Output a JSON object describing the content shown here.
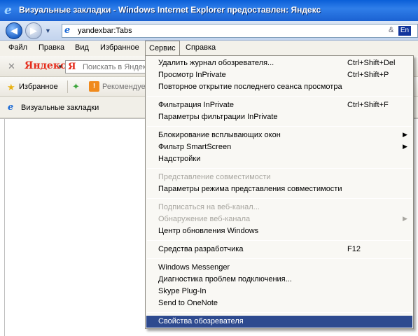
{
  "window": {
    "title": "Визуальные закладки - Windows Internet Explorer предоставлен: Яндекс",
    "app_icon": "ie-logo-icon"
  },
  "address_bar": {
    "url": "yandexbar:Tabs",
    "tail_glyph": "&",
    "language": "En"
  },
  "menu_bar": {
    "items": [
      "Файл",
      "Правка",
      "Вид",
      "Избранное",
      "Сервис",
      "Справка"
    ],
    "active": "Сервис"
  },
  "yandex_toolbar": {
    "close_glyph": "✕",
    "logo": "Яндекс",
    "search_logo": "Я",
    "search_placeholder": "Поискать в Яндексе"
  },
  "favorites_bar": {
    "favorites_label": "Избранное",
    "recommended_label": "Рекомендуе"
  },
  "tab": {
    "label": "Визуальные закладки"
  },
  "tools_menu": {
    "items": [
      {
        "label": "Удалить журнал обозревателя...",
        "shortcut": "Ctrl+Shift+Del",
        "enabled": true
      },
      {
        "label": "Просмотр InPrivate",
        "shortcut": "Ctrl+Shift+P",
        "enabled": true
      },
      {
        "label": "Повторное открытие последнего сеанса просмотра",
        "shortcut": "",
        "enabled": true
      },
      {
        "label": "Фильтрация InPrivate",
        "shortcut": "Ctrl+Shift+F",
        "enabled": true
      },
      {
        "label": "Параметры фильтрации InPrivate",
        "shortcut": "",
        "enabled": true
      },
      {
        "label": "Блокирование всплывающих окон",
        "shortcut": "",
        "submenu": true,
        "enabled": true
      },
      {
        "label": "Фильтр SmartScreen",
        "shortcut": "",
        "submenu": true,
        "enabled": true
      },
      {
        "label": "Надстройки",
        "shortcut": "",
        "enabled": true
      },
      {
        "label": "Представление совместимости",
        "shortcut": "",
        "enabled": false
      },
      {
        "label": "Параметры режима представления совместимости",
        "shortcut": "",
        "enabled": true
      },
      {
        "label": "Подписаться на веб-канал...",
        "shortcut": "",
        "enabled": false
      },
      {
        "label": "Обнаружение веб-канала",
        "shortcut": "",
        "submenu": true,
        "enabled": false
      },
      {
        "label": "Центр обновления Windows",
        "shortcut": "",
        "enabled": true
      },
      {
        "label": "Средства разработчика",
        "shortcut": "F12",
        "enabled": true
      },
      {
        "label": "Windows Messenger",
        "shortcut": "",
        "enabled": true
      },
      {
        "label": "Диагностика проблем подключения...",
        "shortcut": "",
        "enabled": true
      },
      {
        "label": "Skype Plug-In",
        "shortcut": "",
        "enabled": true
      },
      {
        "label": "Send to OneNote",
        "shortcut": "",
        "enabled": true
      },
      {
        "label": "Свойства обозревателя",
        "shortcut": "",
        "enabled": true,
        "highlighted": true
      }
    ]
  }
}
